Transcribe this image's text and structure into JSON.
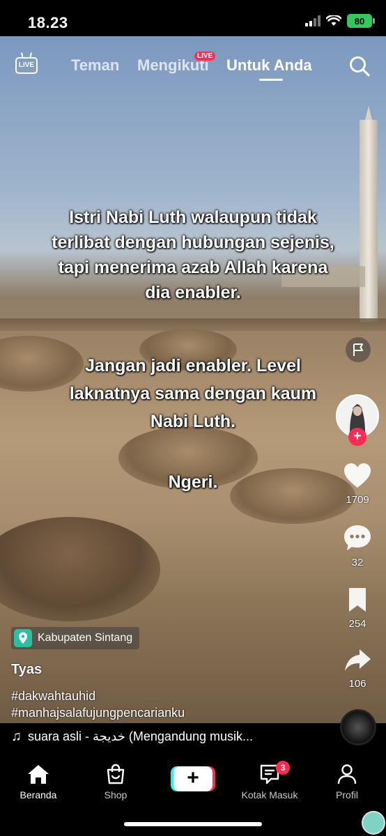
{
  "status_bar": {
    "time": "18.23",
    "battery": "80"
  },
  "top_nav": {
    "live_icon_label": "LIVE",
    "tabs": [
      {
        "label": "Teman"
      },
      {
        "label": "Mengikuti",
        "badge": "LIVE"
      },
      {
        "label": "Untuk Anda",
        "active": true
      }
    ]
  },
  "video": {
    "overlay_lines": [
      "Istri Nabi Luth walaupun tidak",
      "terlibat dengan hubungan sejenis,",
      "tapi menerima azab Allah karena",
      "dia enabler.",
      "Jangan jadi enabler. Level",
      "laknatnya sama dengan kaum",
      "Nabi Luth.",
      "Ngeri."
    ]
  },
  "right_rail": {
    "likes": "1709",
    "comments": "32",
    "saves": "254",
    "shares": "106"
  },
  "post": {
    "location": "Kabupaten Sintang",
    "username": "Tyas",
    "hashtags": [
      "#dakwahtauhid",
      "#manhajsalafujungpencarianku"
    ],
    "music": "suara asli - خديجة (Mengandung musik..."
  },
  "bottom_nav": {
    "items": [
      {
        "label": "Beranda",
        "icon": "home-icon"
      },
      {
        "label": "Shop",
        "icon": "shop-bag-icon"
      },
      {
        "label": "",
        "icon": "create-plus-icon"
      },
      {
        "label": "Kotak Masuk",
        "icon": "inbox-icon",
        "badge": "3"
      },
      {
        "label": "Profil",
        "icon": "profile-icon"
      }
    ]
  },
  "colors": {
    "accent": "#fe2c55",
    "cyan": "#25f4ee",
    "battery": "#34c759"
  }
}
